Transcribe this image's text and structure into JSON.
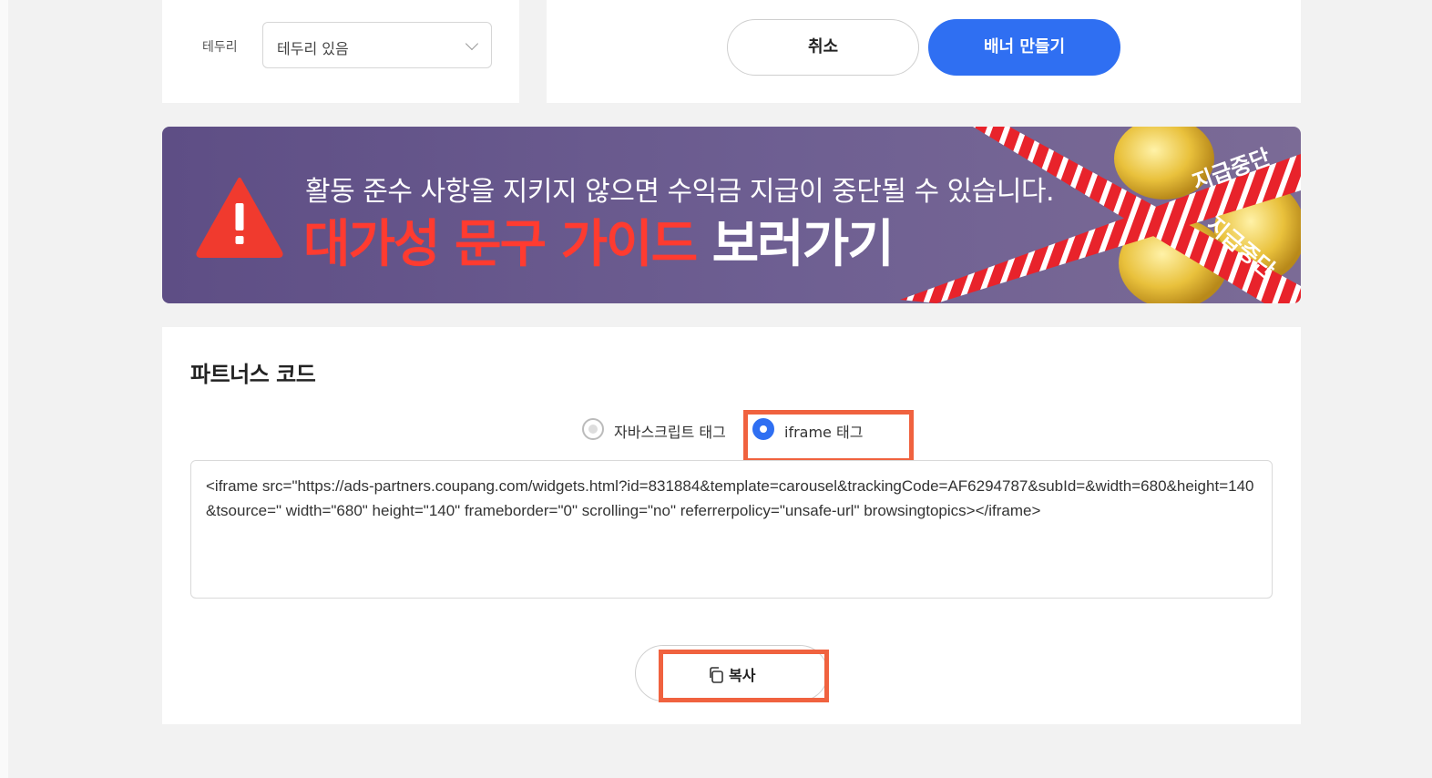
{
  "border_panel": {
    "label": "테두리",
    "select_value": "테두리 있음"
  },
  "actions": {
    "cancel_label": "취소",
    "create_label": "배너 만들기"
  },
  "banner": {
    "line1": "활동 준수 사항을 지키지 않으면 수익금 지급이 중단될 수 있습니다.",
    "line2_red": "대가성 문구 가이드",
    "line2_white": " 보러가기",
    "tape_text_1": "지급중단",
    "tape_text_2": "지급중단",
    "colors": {
      "background": "#5e4e85",
      "accent_red": "#ff3b30"
    }
  },
  "partners_code": {
    "title": "파트너스 코드",
    "radio_options": [
      {
        "label": "자바스크립트 태그",
        "selected": false
      },
      {
        "label": "iframe 태그",
        "selected": true
      }
    ],
    "code_text": "<iframe src=\"https://ads-partners.coupang.com/widgets.html?id=831884&template=carousel&trackingCode=AF6294787&subId=&width=680&height=140&tsource=\" width=\"680\" height=\"140\" frameborder=\"0\" scrolling=\"no\" referrerpolicy=\"unsafe-url\" browsingtopics></iframe>",
    "copy_label": "복사"
  },
  "colors": {
    "primary": "#2f6ff2",
    "highlight": "#f0623f"
  }
}
